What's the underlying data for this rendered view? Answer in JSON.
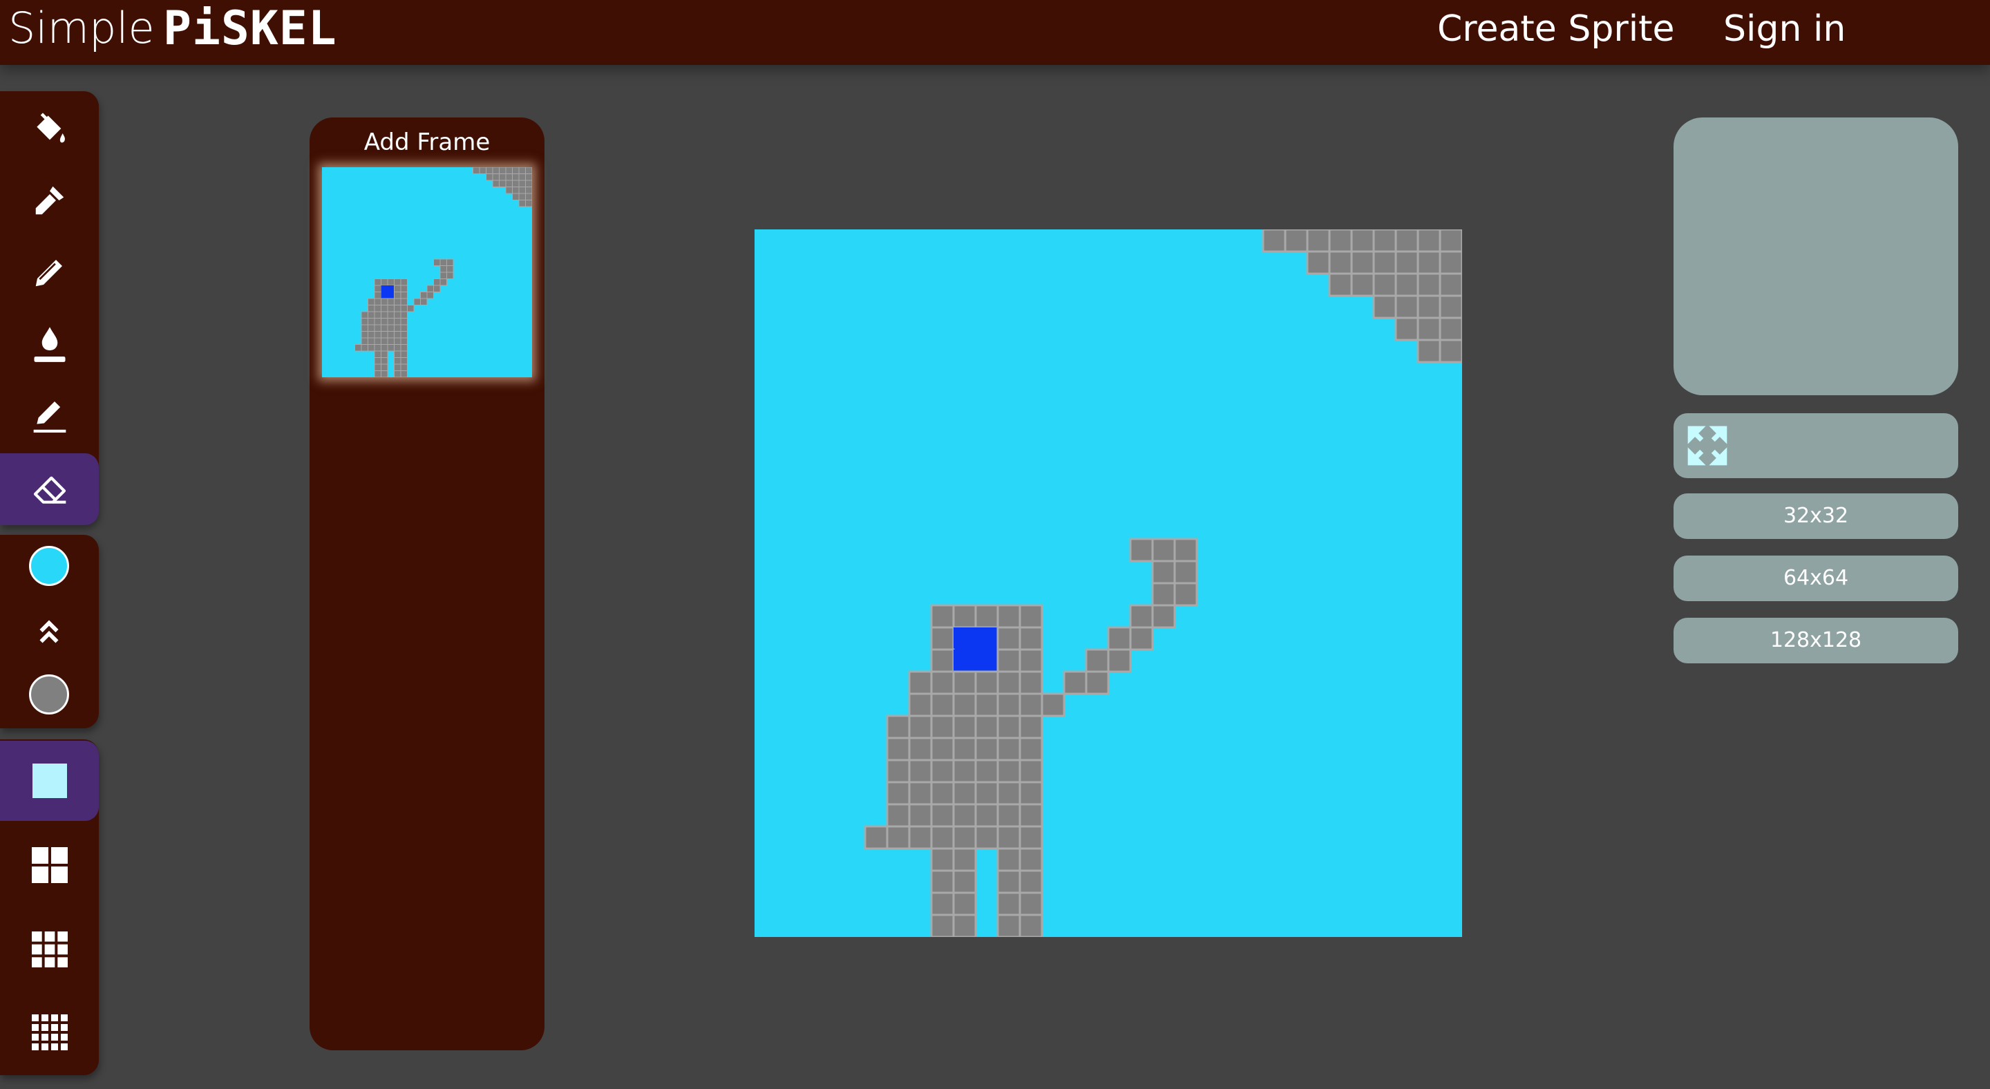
{
  "app": {
    "logo_simple": "Simple",
    "logo_piskel": "PiSKEL",
    "nav": {
      "create_sprite": "Create Sprite",
      "sign_in": "Sign in"
    }
  },
  "tools": [
    {
      "name": "paint-bucket-icon"
    },
    {
      "name": "eyedropper-icon"
    },
    {
      "name": "pencil-icon"
    },
    {
      "name": "fill-drop-icon"
    },
    {
      "name": "line-pencil-icon"
    },
    {
      "name": "eraser-icon",
      "active": true
    }
  ],
  "colors": {
    "primary": "#29d8f9",
    "secondary": "#808080",
    "background": "#434343",
    "panel": "#3f0f03",
    "accent": "#4a2a73",
    "side_button": "#8fa3a3",
    "robot_eye": "#0b36f2"
  },
  "brush_sizes": [
    {
      "name": "brush-size-1-icon",
      "active": true
    },
    {
      "name": "brush-size-2-icon"
    },
    {
      "name": "brush-size-3-icon"
    },
    {
      "name": "brush-size-4-icon"
    }
  ],
  "frames": {
    "add_frame_label": "Add Frame"
  },
  "canvas": {
    "grid_size": 32
  },
  "side": {
    "fullscreen_icon": "expand-arrows-icon",
    "sizes": [
      "32x32",
      "64x64",
      "128x128"
    ]
  }
}
